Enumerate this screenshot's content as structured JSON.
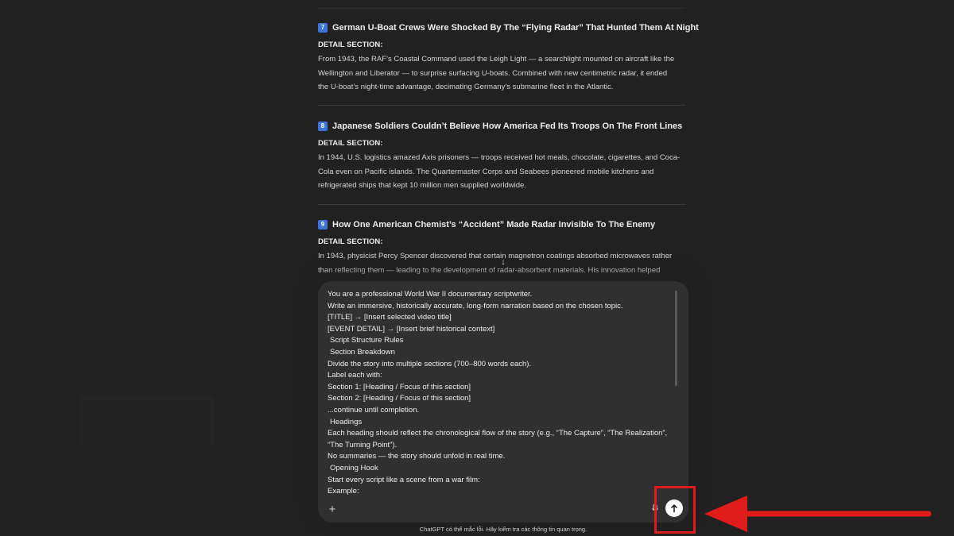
{
  "articles": [
    {
      "number": "7",
      "title": "German U-Boat Crews Were Shocked By The “Flying Radar” That Hunted Them At Night",
      "detail_label": "DETAIL SECTION:",
      "lines": [
        "From 1943, the RAF’s Coastal Command used the Leigh Light — a searchlight mounted on aircraft like the",
        "Wellington and Liberator — to surprise surfacing U-boats. Combined with new centimetric radar, it ended",
        "the U-boat’s night-time advantage, decimating Germany’s submarine fleet in the Atlantic."
      ]
    },
    {
      "number": "8",
      "title": "Japanese Soldiers Couldn’t Believe How America Fed Its Troops On The Front Lines",
      "detail_label": "DETAIL SECTION:",
      "lines": [
        "In 1944, U.S. logistics amazed Axis prisoners — troops received hot meals, chocolate, cigarettes, and Coca-",
        "Cola even on Pacific islands. The Quartermaster Corps and Seabees pioneered mobile kitchens and",
        "refrigerated ships that kept 10 million men supplied worldwide."
      ]
    },
    {
      "number": "9",
      "title": "How One American Chemist’s “Accident” Made Radar Invisible To The Enemy",
      "detail_label": "DETAIL SECTION:",
      "lines": [
        "In 1943, physicist Percy Spencer discovered that certain magnetron coatings absorbed microwaves rather",
        "than reflecting them — leading to the development of radar-absorbent materials. His innovation helped"
      ]
    }
  ],
  "composer": {
    "lines": [
      "You are a professional World War II documentary scriptwriter.",
      "Write an immersive, historically accurate, long-form narration based on the chosen topic.",
      "[TITLE] → [Insert selected video title]",
      "[EVENT DETAIL] → [Insert brief historical context]",
      " Script Structure Rules",
      " Section Breakdown",
      "Divide the story into multiple sections (700–800 words each).",
      "Label each with:",
      "Section 1: [Heading / Focus of this section]",
      "Section 2: [Heading / Focus of this section]",
      "...continue until completion.",
      " Headings",
      "Each heading should reflect the chronological flow of the story (e.g., “The Capture”, “The Realization”,",
      "“The Turning Point”).",
      "No summaries — the story should unfold in real time.",
      " Opening Hook",
      "Start every script like a scene from a war film:",
      "Example:"
    ],
    "plus_icon": "plus-icon",
    "mic_icon": "microphone-icon",
    "send_icon": "arrow-up-icon"
  },
  "scroll_icon": "arrow-down-icon",
  "disclaimer": "ChatGPT có thể mắc lỗi. Hãy kiểm tra các thông tin quan trọng.",
  "colors": {
    "background": "#212121",
    "composer": "#303030",
    "annotation": "#e01b1b",
    "badge": "#3d73d6"
  }
}
